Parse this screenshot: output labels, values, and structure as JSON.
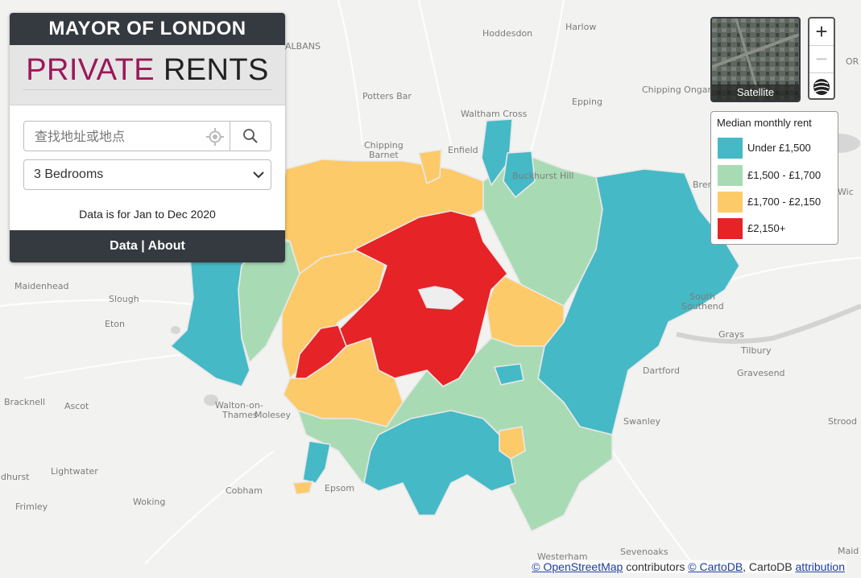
{
  "header": {
    "mayor": "MAYOR OF LONDON",
    "title_a": "PRIVATE",
    "title_b": "RENTS"
  },
  "search": {
    "placeholder": "查找地址或地点"
  },
  "bedrooms": {
    "selected": "3 Bedrooms"
  },
  "note": "Data is for Jan to Dec 2020",
  "footer": {
    "data": "Data",
    "sep": "|",
    "about": "About"
  },
  "basemap": {
    "label": "Satellite"
  },
  "zoom": {
    "in": "+",
    "out": "−"
  },
  "legend": {
    "title": "Median monthly rent",
    "items": [
      {
        "label": "Under £1,500",
        "color": "#45b9c6"
      },
      {
        "label": "£1,500 - £1,700",
        "color": "#a8dbb4"
      },
      {
        "label": "£1,700 - £2,150",
        "color": "#fdca6a"
      },
      {
        "label": "£2,150+",
        "color": "#e62326"
      }
    ]
  },
  "attribution": {
    "osm": "© OpenStreetMap",
    "contributors": "contributors",
    "carto": "© CartoDB",
    "cartodb": ", CartoDB",
    "attribution": "attribution"
  },
  "places": [
    "Hoddesdon",
    "Harlow",
    "ALBANS",
    "Potters Bar",
    "Waltham Cross",
    "Epping",
    "Chipping Ongar",
    "Chipping Barnet",
    "Enfield",
    "Buckhurst Hill",
    "Maidenhead",
    "Slough",
    "Eton",
    "Southend-on-Sea",
    "Grays",
    "Tilbury",
    "Dartford",
    "Gravesend",
    "Bracknell",
    "Ascot",
    "Walton-on-Thames",
    "Molesey",
    "Swanley",
    "Lightwater",
    "Cobham",
    "Epsom",
    "Woking",
    "Frimley",
    "Westerham",
    "Sevenoaks",
    "Strood",
    "Maid"
  ]
}
